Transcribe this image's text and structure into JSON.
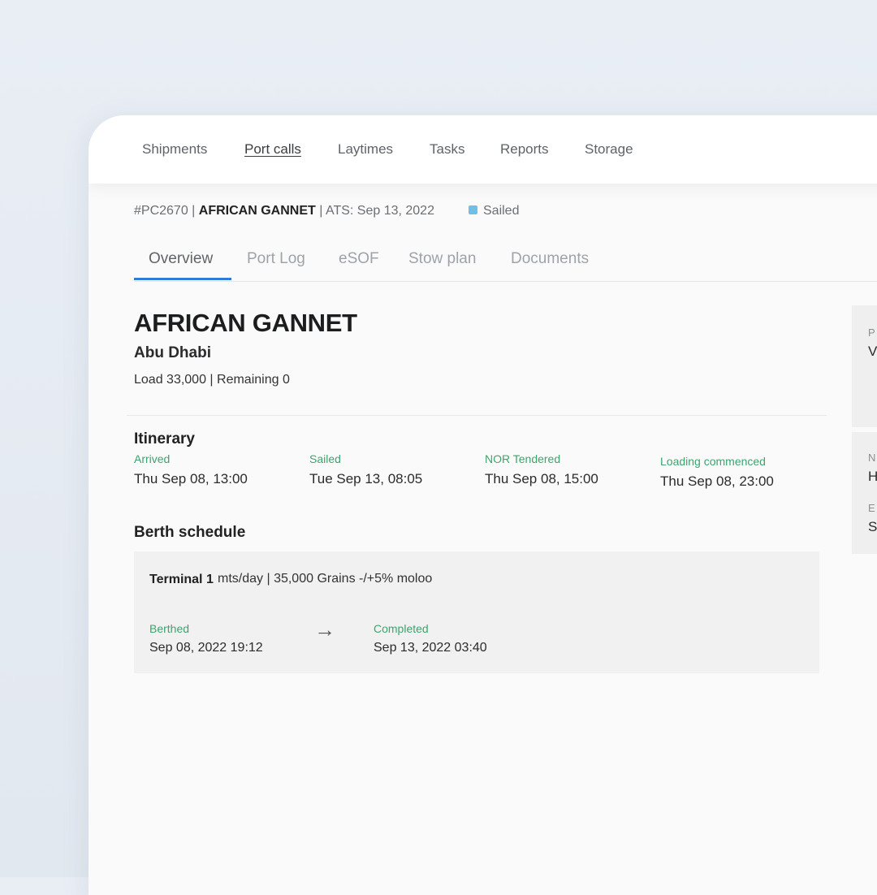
{
  "nav": {
    "items": [
      {
        "label": "Shipments"
      },
      {
        "label": "Port calls"
      },
      {
        "label": "Laytimes"
      },
      {
        "label": "Tasks"
      },
      {
        "label": "Reports"
      },
      {
        "label": "Storage"
      }
    ],
    "active": "Port calls"
  },
  "header": {
    "id": "#PC2670",
    "vessel": "AFRICAN GANNET",
    "ats": "ATS: Sep 13, 2022",
    "status": "Sailed",
    "status_color": "#6ec1e4"
  },
  "tabs": [
    {
      "label": "Overview"
    },
    {
      "label": "Port Log"
    },
    {
      "label": "eSOF"
    },
    {
      "label": "Stow plan"
    },
    {
      "label": "Documents"
    }
  ],
  "active_tab": "Overview",
  "vessel": {
    "name": "AFRICAN GANNET",
    "port": "Abu Dhabi",
    "load_summary": "Load 33,000 | Remaining 0"
  },
  "itinerary": {
    "title": "Itinerary",
    "events": [
      {
        "label": "Arrived",
        "value": "Thu Sep 08, 13:00"
      },
      {
        "label": "Sailed",
        "value": "Tue Sep 13, 08:05"
      },
      {
        "label": "NOR Tendered",
        "value": "Thu Sep 08, 15:00"
      },
      {
        "label": "Loading commenced",
        "value": "Thu Sep 08, 23:00"
      }
    ]
  },
  "berth": {
    "title": "Berth schedule",
    "terminal": "Terminal 1",
    "description": "mts/day | 35,000 Grains -/+5% moloo",
    "berthed_label": "Berthed",
    "berthed_value": "Sep 08, 2022 19:12",
    "arrow": "→",
    "completed_label": "Completed",
    "completed_value": "Sep 13, 2022 03:40"
  },
  "side_panel": {
    "card1_label": "P",
    "card1_value": "V",
    "card2_label1": "N",
    "card2_value1": "H",
    "card2_label2": "E",
    "card2_value2": "S"
  },
  "colors": {
    "accent": "#2e7cd6",
    "green_label": "#3fa36e",
    "status_sailed": "#6ec1e4"
  }
}
